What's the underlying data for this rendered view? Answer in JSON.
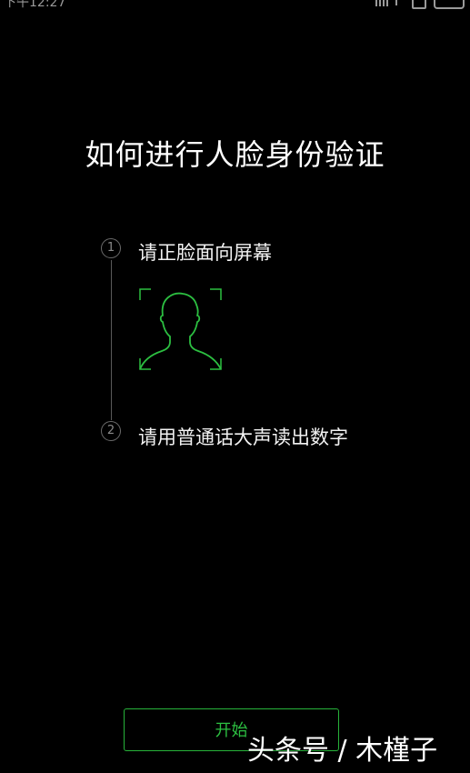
{
  "status_bar": {
    "time": "下午12:27"
  },
  "page": {
    "title": "如何进行人脸身份验证"
  },
  "steps": [
    {
      "number": "1",
      "label": "请正脸面向屏幕"
    },
    {
      "number": "2",
      "label": "请用普通话大声读出数字"
    }
  ],
  "actions": {
    "start_label": "开始"
  },
  "watermark": {
    "text": "头条号 / 木槿子"
  },
  "colors": {
    "background": "#000000",
    "accent_green": "#2cbf41",
    "text": "#ffffff"
  },
  "icons": {
    "face_frame": "face-outline-icon"
  }
}
